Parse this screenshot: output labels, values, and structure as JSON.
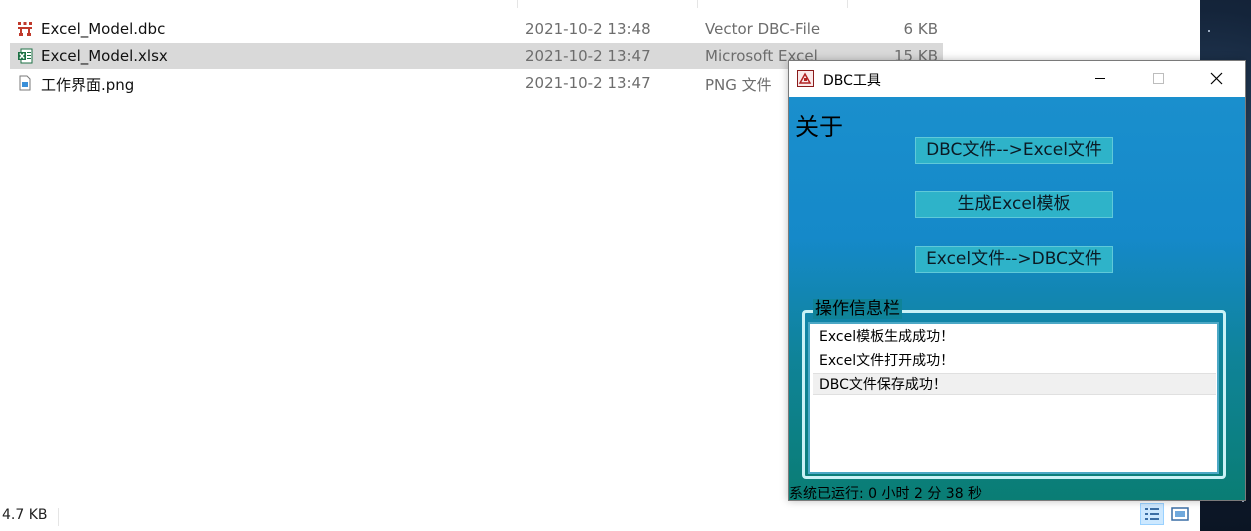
{
  "explorer": {
    "files": [
      {
        "name": "Excel_Model.dbc",
        "date": "2021-10-2 13:48",
        "type": "Vector DBC-File",
        "size": "6 KB",
        "icon": "dbc-file-icon",
        "selected": false
      },
      {
        "name": "Excel_Model.xlsx",
        "date": "2021-10-2 13:47",
        "type": "Microsoft Excel",
        "size": "15 KB",
        "icon": "excel-file-icon",
        "selected": true
      },
      {
        "name": "工作界面.png",
        "date": "2021-10-2 13:47",
        "type": "PNG 文件",
        "size": "",
        "icon": "png-file-icon",
        "selected": false
      }
    ],
    "status_size": "4.7 KB"
  },
  "dbc_window": {
    "title": "DBC工具",
    "about_label": "关于",
    "buttons": {
      "dbc_to_excel": "DBC文件-->Excel文件",
      "gen_template": "生成Excel模板",
      "excel_to_dbc": "Excel文件-->DBC文件"
    },
    "info_group": {
      "legend": "操作信息栏",
      "messages": [
        "Excel模板生成成功！",
        "Excel文件打开成功！",
        "DBC文件保存成功！"
      ],
      "selected_index": 2
    },
    "runtime": "系统已运行:  0 小时 2 分 38 秒"
  },
  "colors": {
    "accent_top": "#1a8fcd",
    "accent_bottom": "#0a7d74",
    "button_bg": "#2eb3c9",
    "selection": "#d9d9d9"
  }
}
